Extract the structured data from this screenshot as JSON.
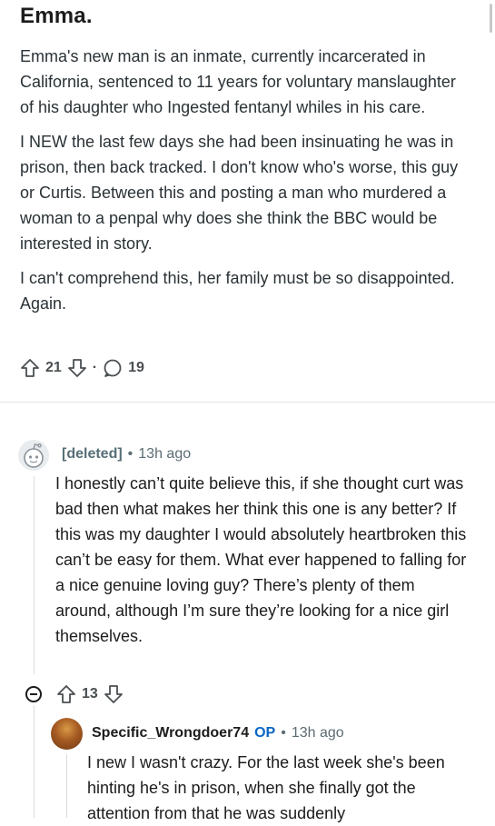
{
  "post": {
    "title": "Emma.",
    "paragraphs": [
      "Emma's new man is an inmate, currently incarcerated in California, sentenced to 11 years for voluntary manslaughter of his daughter who Ingested fentanyl whiles in his care.",
      "I NEW the last few days she had been insinuating he was in prison, then back tracked. I don't know who's worse, this guy or Curtis. Between this and posting a man who murdered a woman to a penpal why does she think the BBC would be interested in story.",
      "I can't comprehend this, her family must be so disappointed. Again."
    ],
    "upvotes": "21",
    "vote_separator": "·",
    "comments": "19",
    "icons": [
      "upvote-icon",
      "downvote-icon",
      "comment-icon"
    ]
  },
  "comments": [
    {
      "author": "[deleted]",
      "separator": "•",
      "time": "13h ago",
      "body": "I honestly can’t quite believe this, if she thought curt was bad then what makes her think this one is any better? If this was my daughter I would absolutely heartbroken this can’t be easy for them. What ever happened to falling for a nice genuine loving guy? There’s plenty of them around, although I’m sure they’re looking for a nice girl themselves.",
      "votes": "13",
      "icons": [
        "deleted-user-avatar-icon",
        "collapse-icon",
        "upvote-icon",
        "downvote-icon"
      ]
    },
    {
      "author": "Specific_Wrongdoer74",
      "badge": "OP",
      "separator": "•",
      "time": "13h ago",
      "body": "I new I wasn't crazy. For the last week she's been hinting he's in prison, when she finally got the attention from that he was suddenly"
    }
  ]
}
